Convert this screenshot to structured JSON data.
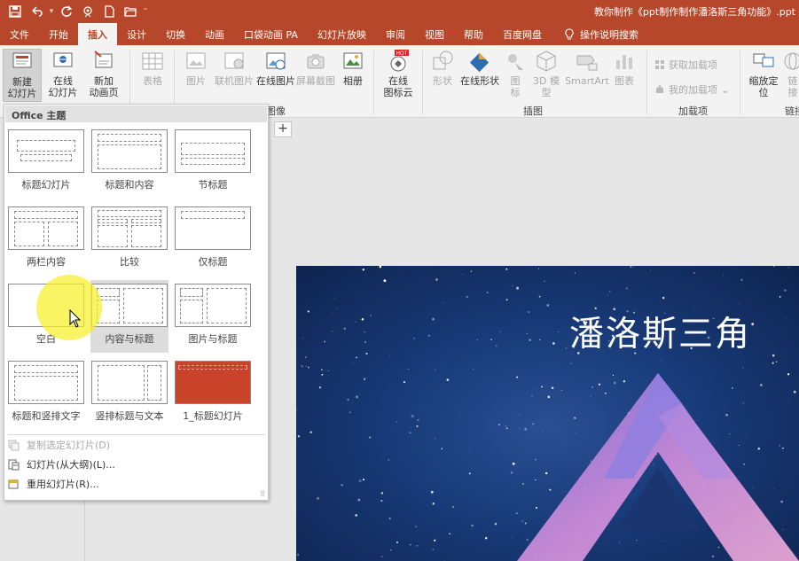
{
  "window": {
    "title": "教你制作《ppt制作制作潘洛斯三角功能》.ppt",
    "accent": "#b7472a"
  },
  "qat": {
    "icons": [
      "save-icon",
      "undo-icon",
      "redo-icon",
      "presenter-icon",
      "new-file-icon",
      "open-folder-icon",
      "customize-icon"
    ]
  },
  "tabs": [
    "文件",
    "开始",
    "插入",
    "设计",
    "切换",
    "动画",
    "口袋动画 PA",
    "幻灯片放映",
    "审阅",
    "视图",
    "帮助",
    "百度网盘"
  ],
  "active_tab": "插入",
  "tell_me": "操作说明搜索",
  "ribbon": {
    "new_slide": [
      "新建",
      "幻灯片"
    ],
    "online_slide": [
      "在线",
      "幻灯片"
    ],
    "new_anim_page": [
      "新加",
      "动画页"
    ],
    "table": "表格",
    "picture": "图片",
    "online_picture_small": "联机图片",
    "online_picture": "在线图片",
    "screenshot": "屏幕截图",
    "album": "相册",
    "online_icons": [
      "在线",
      "图标云"
    ],
    "hot_badge": "HOT",
    "shapes": "形状",
    "online_shapes": "在线形状",
    "icons": [
      "图",
      "标"
    ],
    "model3d": [
      "3D 模",
      "型"
    ],
    "smartart": "SmartArt",
    "chart": "图表",
    "get_addins": "获取加载项",
    "my_addins": "我的加载项",
    "zoom": [
      "缩放定",
      "位"
    ],
    "link": [
      "链",
      "接"
    ],
    "group_images": "图像",
    "group_illustrations": "插图",
    "group_addins": "加载项",
    "group_links": "链接"
  },
  "dropdown": {
    "header": "Office 主题",
    "layouts": [
      "标题幻灯片",
      "标题和内容",
      "节标题",
      "两栏内容",
      "比较",
      "仅标题",
      "空白",
      "内容与标题",
      "图片与标题",
      "标题和竖排文字",
      "竖排标题与文本",
      "1_标题幻灯片"
    ],
    "duplicate": "复制选定幻灯片(D)",
    "from_outline": "幻灯片(从大纲)(L)...",
    "reuse": "重用幻灯片(R)...",
    "custom_layout_color": "#c9432a"
  },
  "editor": {
    "add_button": "+"
  },
  "slide": {
    "title": "潘洛斯三角"
  }
}
